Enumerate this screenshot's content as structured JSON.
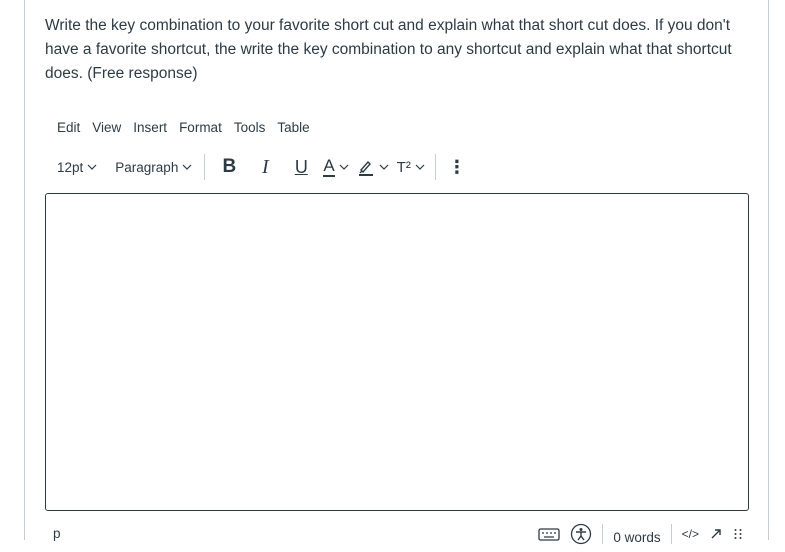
{
  "question": {
    "text": "Write the key combination to your favorite short cut and explain what that short cut does.  If you don't have a favorite shortcut, the write the key combination to any shortcut and explain what that shortcut does.  (Free response)"
  },
  "menubar": {
    "items": [
      "Edit",
      "View",
      "Insert",
      "Format",
      "Tools",
      "Table"
    ]
  },
  "toolbar": {
    "font_size": "12pt",
    "block_format": "Paragraph",
    "bold": "B",
    "italic": "I",
    "underline": "U",
    "text_color": "A",
    "superscript": "T²",
    "more": "⋮"
  },
  "editor": {
    "content": ""
  },
  "statusbar": {
    "path": "p",
    "word_count": "0 words",
    "code_view": "</>"
  },
  "colors": {
    "text": "#2d3b45",
    "border": "#c7cdd1"
  }
}
